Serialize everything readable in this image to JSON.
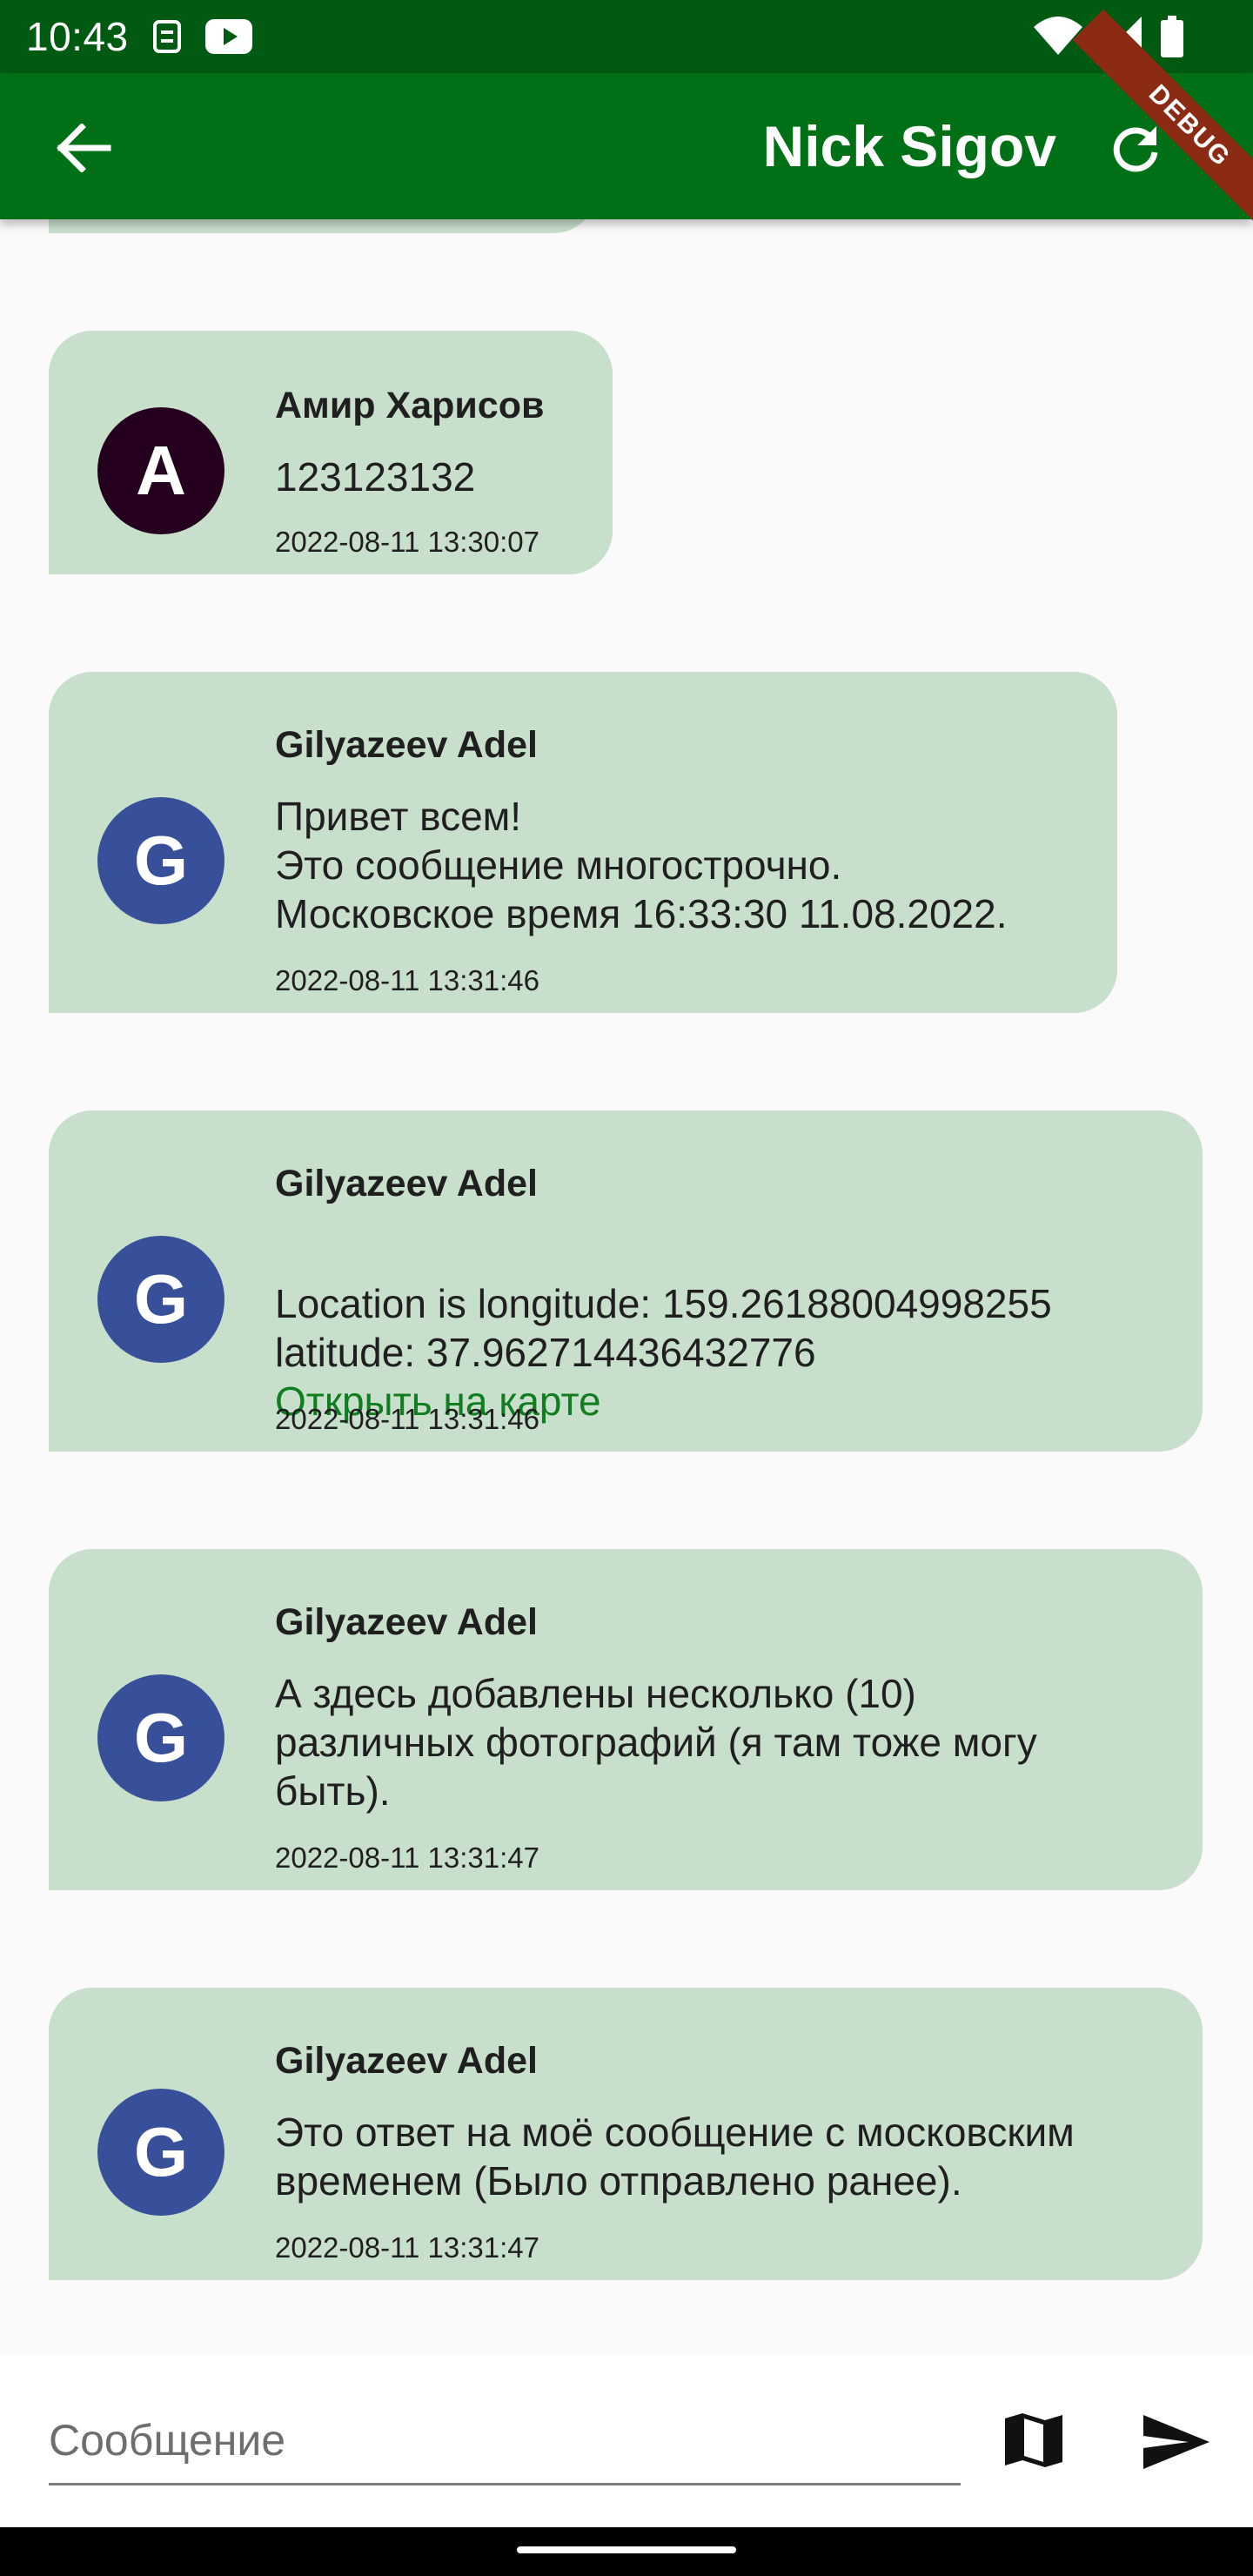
{
  "status_bar": {
    "time": "10:43",
    "icons": [
      "sim-icon",
      "youtube-icon",
      "wifi-icon",
      "signal-icon",
      "battery-icon"
    ]
  },
  "app_bar": {
    "title": "Nick Sigov",
    "debug_label": "DEBUG",
    "color": "#007016"
  },
  "messages": [
    {
      "avatar_letter": "A",
      "avatar_color": "#24001e",
      "sender": "Амир Харисов",
      "text": "123123132",
      "time": "2022-08-11 13:30:07"
    },
    {
      "avatar_letter": "G",
      "avatar_color": "#384f99",
      "sender": "Gilyazeev Adel",
      "text": "Привет всем!\nЭто сообщение многострочно.\nМосковское время 16:33:30 11.08.2022.",
      "time": "2022-08-11 13:31:46"
    },
    {
      "avatar_letter": "G",
      "avatar_color": "#384f99",
      "sender": "Gilyazeev Adel",
      "text": "Location is  longitude: 159.26188004998255\nlatitude: 37.962714436432776",
      "link": "Открыть на карте",
      "time": "2022-08-11 13:31:46"
    },
    {
      "avatar_letter": "G",
      "avatar_color": "#384f99",
      "sender": "Gilyazeev Adel",
      "text": "А здесь добавлены несколько (10)\nразличных фотографий (я там тоже могу\nбыть).",
      "time": "2022-08-11 13:31:47"
    },
    {
      "avatar_letter": "G",
      "avatar_color": "#384f99",
      "sender": "Gilyazeev Adel",
      "text": "Это ответ на моё сообщение с московским\nвременем (Было отправлено ранее).",
      "time": "2022-08-11 13:31:47"
    }
  ],
  "input": {
    "placeholder": "Сообщение",
    "value": ""
  },
  "colors": {
    "bubble": "#c8dfcc",
    "link": "#0f7d20"
  }
}
